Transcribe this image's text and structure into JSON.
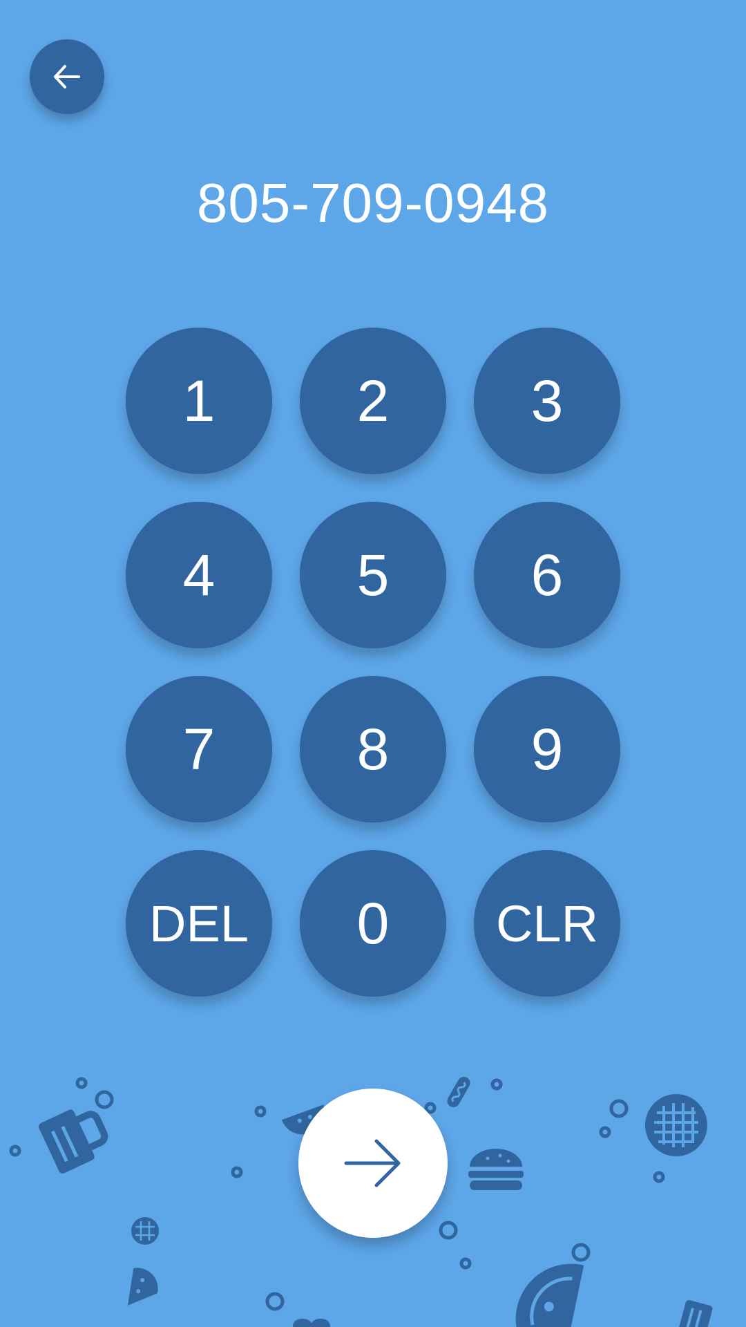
{
  "phone": {
    "number": "805-709-0948"
  },
  "keypad": {
    "keys": [
      "1",
      "2",
      "3",
      "4",
      "5",
      "6",
      "7",
      "8",
      "9",
      "DEL",
      "0",
      "CLR"
    ]
  },
  "icons": {
    "back": "arrow-left-icon",
    "submit": "arrow-right-icon"
  },
  "colors": {
    "background": "#5da6e8",
    "key": "#30659f",
    "text": "#ffffff",
    "submit_button": "#ffffff"
  }
}
